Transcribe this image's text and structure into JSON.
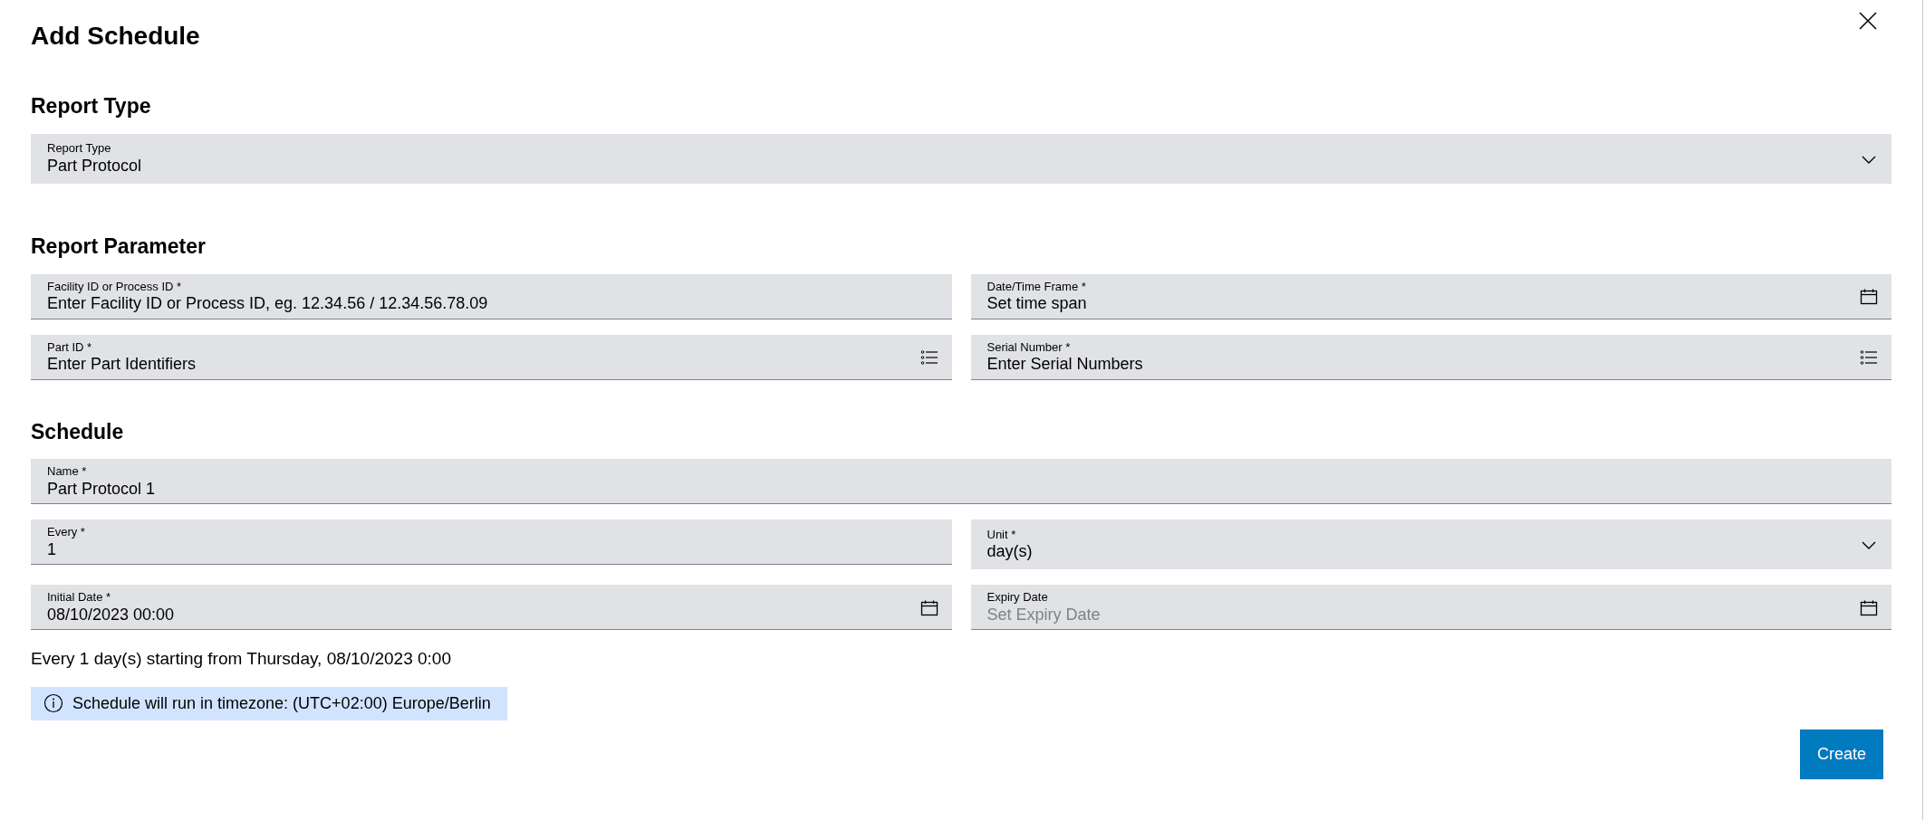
{
  "dialog": {
    "title": "Add Schedule"
  },
  "sections": [
    {
      "heading": "Report Type",
      "rows": [
        [
          {
            "label": "Report Type",
            "value": "Part Protocol",
            "kind": "select"
          }
        ]
      ]
    },
    {
      "heading": "Report Parameter",
      "rows": [
        [
          {
            "label": "Facility ID or Process ID *",
            "value": "Enter Facility ID or Process ID, eg. 12.34.56 / 12.34.56.78.09",
            "kind": "input"
          },
          {
            "label": "Date/Time Frame *",
            "value": "Set time span",
            "kind": "date"
          }
        ],
        [
          {
            "label": "Part ID *",
            "value": "Enter Part Identifiers",
            "kind": "list"
          },
          {
            "label": "Serial Number *",
            "value": "Enter Serial Numbers",
            "kind": "list"
          }
        ]
      ]
    },
    {
      "heading": "Schedule",
      "rows": [
        [
          {
            "label": "Name *",
            "value": "Part Protocol 1",
            "kind": "input"
          }
        ],
        [
          {
            "label": "Every *",
            "value": "1",
            "kind": "input"
          },
          {
            "label": "Unit *",
            "value": "day(s)",
            "kind": "select"
          }
        ],
        [
          {
            "label": "Initial Date *",
            "value": "08/10/2023 00:00",
            "kind": "date"
          },
          {
            "label": "Expiry Date",
            "placeholder": "Set Expiry Date",
            "kind": "date"
          }
        ]
      ]
    }
  ],
  "summary": "Every 1 day(s) starting from Thursday, 08/10/2023 0:00",
  "info": "Schedule will run in timezone: (UTC+02:00) Europe/Berlin",
  "create_button": "Create"
}
